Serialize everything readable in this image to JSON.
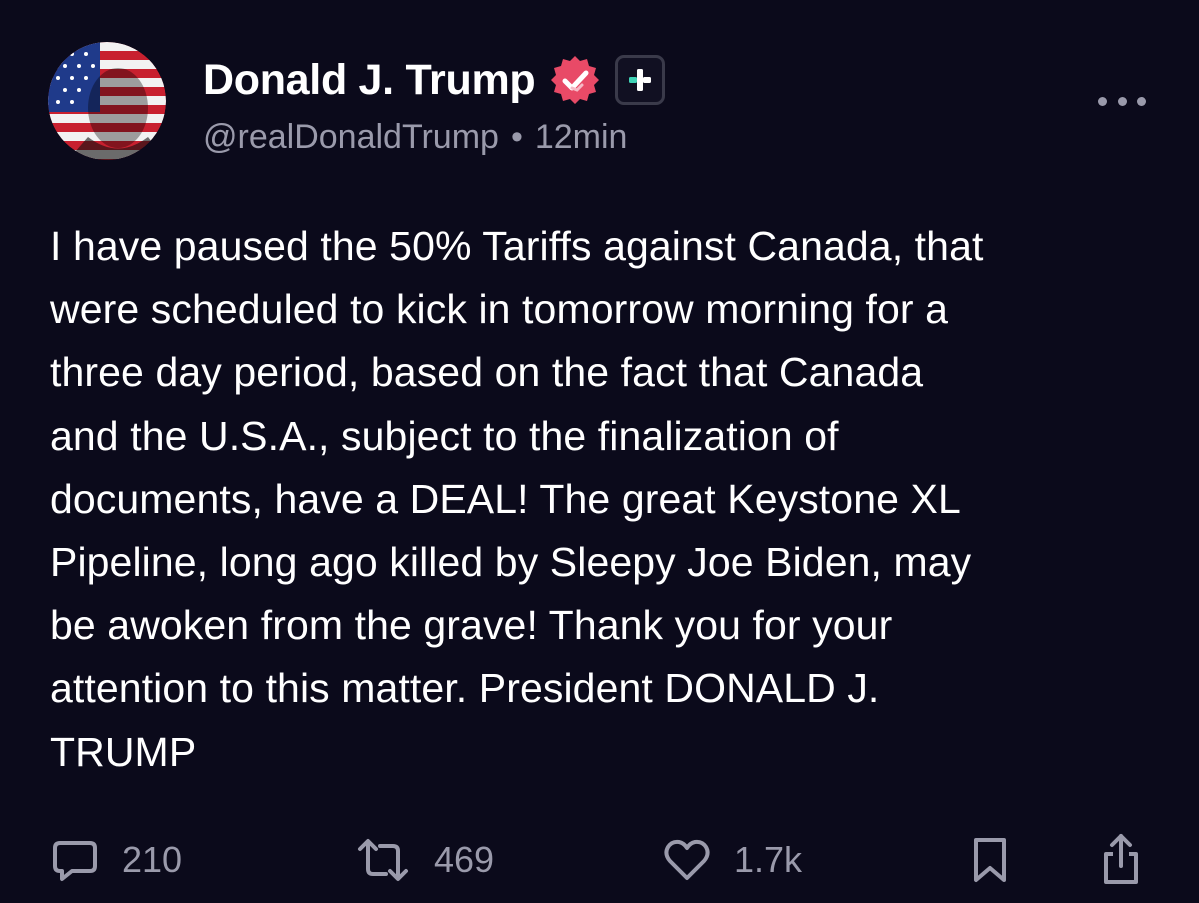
{
  "user": {
    "display_name": "Donald J. Trump",
    "handle": "@realDonaldTrump",
    "separator": "•",
    "time": "12min",
    "verified_icon": "verified-badge-icon",
    "plus_icon": "plus-badge-icon",
    "verified_color": "#e84a67",
    "plus_color": "#3fd3b6"
  },
  "post": {
    "text": "I have paused the 50% Tariffs against Canada, that\nwere scheduled to kick in tomorrow morning for a\nthree day period, based on the fact that Canada\nand the U.S.A., subject to the finalization of\ndocuments, have a DEAL! The great Keystone XL\nPipeline, long ago killed by Sleepy Joe Biden, may\nbe awoken from the grave! Thank you for your\nattention to this matter. President DONALD J.\nTRUMP"
  },
  "actions": {
    "replies": "210",
    "reposts": "469",
    "likes": "1.7k"
  },
  "colors": {
    "background": "#0b0a1b",
    "text": "#ffffff",
    "muted": "#9a9aab"
  }
}
